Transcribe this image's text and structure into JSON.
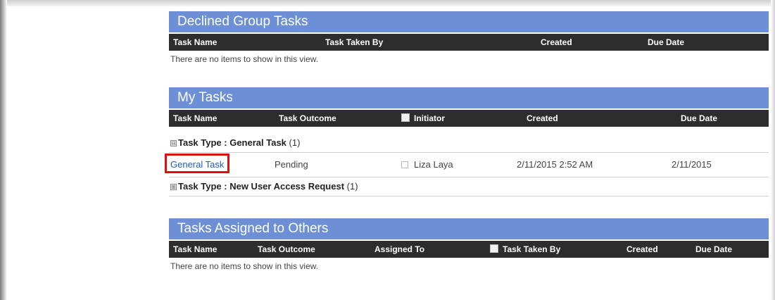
{
  "declined": {
    "title": "Declined Group Tasks",
    "columns": [
      "Task Name",
      "Task Taken By",
      "Created",
      "Due Date"
    ],
    "empty_message": "There are no items to show in this view."
  },
  "my_tasks": {
    "title": "My Tasks",
    "columns": [
      "Task Name",
      "Task Outcome",
      "Initiator",
      "Created",
      "Due Date"
    ],
    "groups": [
      {
        "label": "Task Type",
        "value": "General Task",
        "count": "(1)",
        "expander": "⊟"
      },
      {
        "label": "Task Type",
        "value": "New User Access Request",
        "count": "(1)",
        "expander": "⊞"
      }
    ],
    "rows": [
      {
        "name": "General Task",
        "outcome": "Pending",
        "initiator": "Liza Laya",
        "created": "2/11/2015 2:52 AM",
        "due": "2/11/2015"
      }
    ]
  },
  "assigned_to_others": {
    "title": "Tasks Assigned to Others",
    "columns": [
      "Task Name",
      "Task Outcome",
      "Assigned To",
      "Task Taken By",
      "Created",
      "Due Date"
    ],
    "empty_message": "There are no items to show in this view."
  }
}
